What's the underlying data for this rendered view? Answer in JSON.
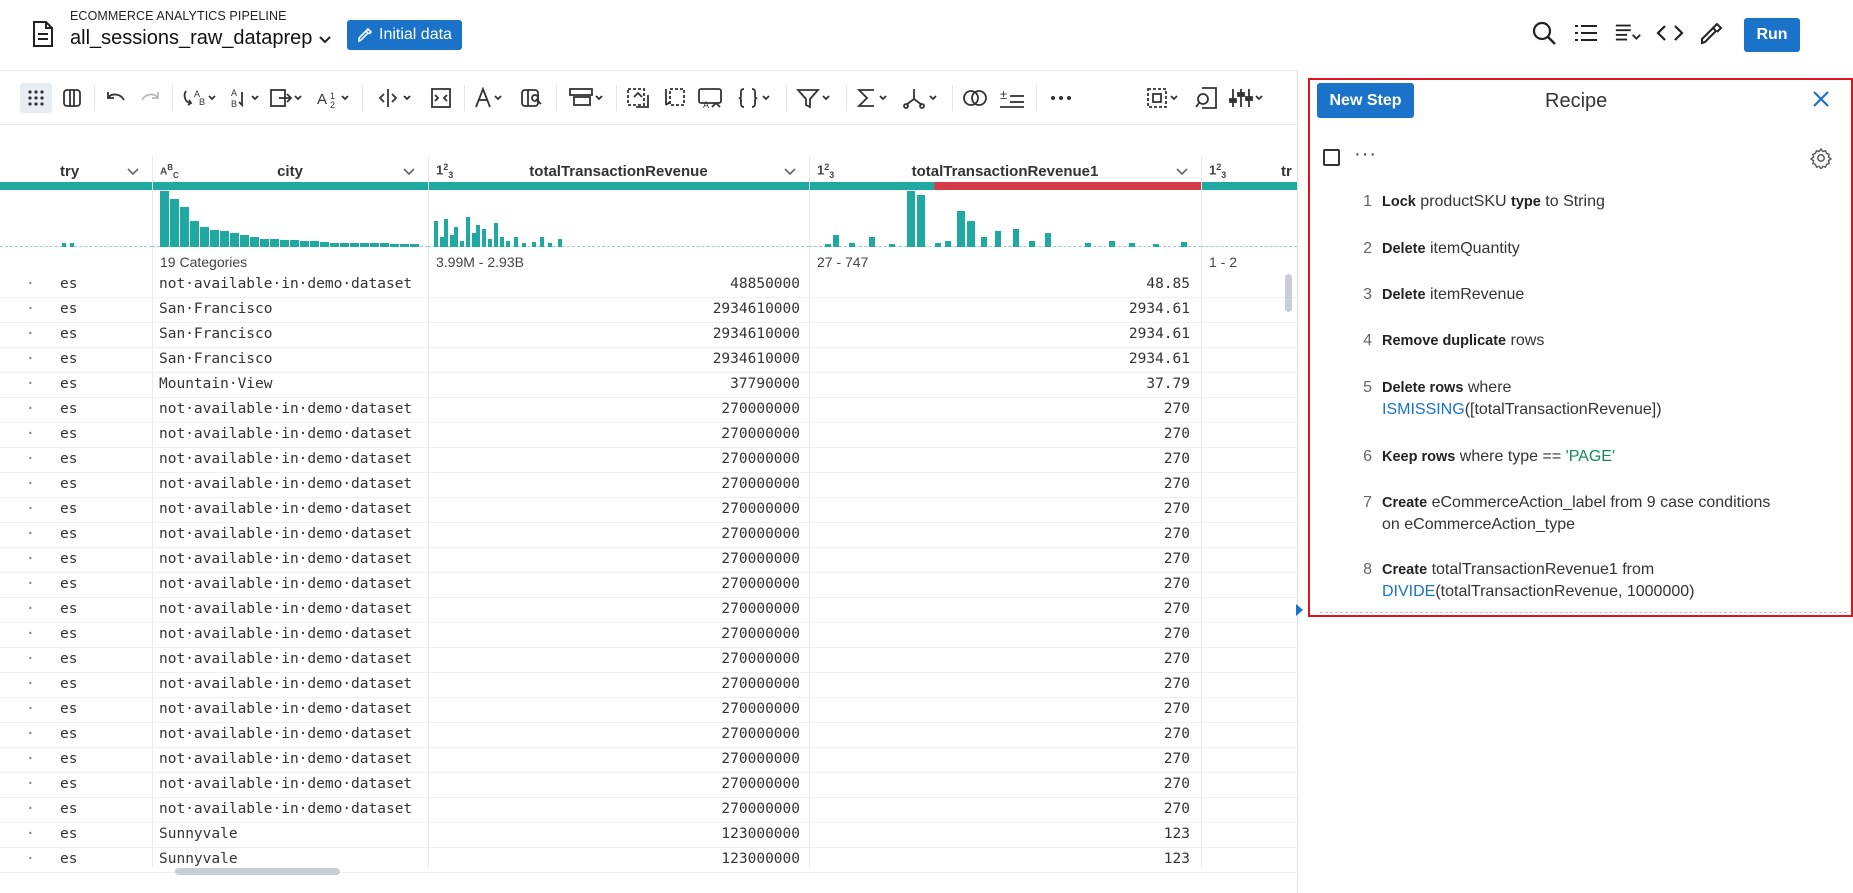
{
  "header": {
    "pipeline_label": "ECOMMERCE ANALYTICS PIPELINE",
    "recipe_name": "all_sessions_raw_dataprep",
    "initial_data_label": "Initial data",
    "run_label": "Run"
  },
  "toolbar": {
    "icons": [
      "grid-view-icon",
      "columns-view-icon",
      "undo-icon",
      "redo-icon",
      "change-type-icon",
      "sort-icon",
      "move-icon",
      "rename-icon",
      "split-icon",
      "merge-icon",
      "format-icon",
      "replace-icon",
      "restructure-icon",
      "nest-icon",
      "unnest-icon",
      "extract-icon",
      "json-icon",
      "filter-icon",
      "aggregate-icon",
      "join-icon",
      "union-icon",
      "new-formula-icon",
      "more-icon",
      "select-icon",
      "lookup-icon",
      "settings-sliders-icon"
    ]
  },
  "grid": {
    "columns": [
      {
        "name": "try",
        "type": "",
        "range": ""
      },
      {
        "name": "city",
        "type": "ABC",
        "range": "19 Categories"
      },
      {
        "name": "totalTransactionRevenue",
        "type": "123",
        "range": "3.99M - 2.93B"
      },
      {
        "name": "totalTransactionRevenue1",
        "type": "123",
        "range": "27 - 747"
      },
      {
        "name": "tr",
        "type": "123",
        "range": "1 - 2"
      }
    ],
    "rows": [
      [
        "es",
        "not available in demo dataset",
        "48850000",
        "48.85"
      ],
      [
        "es",
        "San Francisco",
        "2934610000",
        "2934.61"
      ],
      [
        "es",
        "San Francisco",
        "2934610000",
        "2934.61"
      ],
      [
        "es",
        "San Francisco",
        "2934610000",
        "2934.61"
      ],
      [
        "es",
        "Mountain View",
        "37790000",
        "37.79"
      ],
      [
        "es",
        "not available in demo dataset",
        "270000000",
        "270"
      ],
      [
        "es",
        "not available in demo dataset",
        "270000000",
        "270"
      ],
      [
        "es",
        "not available in demo dataset",
        "270000000",
        "270"
      ],
      [
        "es",
        "not available in demo dataset",
        "270000000",
        "270"
      ],
      [
        "es",
        "not available in demo dataset",
        "270000000",
        "270"
      ],
      [
        "es",
        "not available in demo dataset",
        "270000000",
        "270"
      ],
      [
        "es",
        "not available in demo dataset",
        "270000000",
        "270"
      ],
      [
        "es",
        "not available in demo dataset",
        "270000000",
        "270"
      ],
      [
        "es",
        "not available in demo dataset",
        "270000000",
        "270"
      ],
      [
        "es",
        "not available in demo dataset",
        "270000000",
        "270"
      ],
      [
        "es",
        "not available in demo dataset",
        "270000000",
        "270"
      ],
      [
        "es",
        "not available in demo dataset",
        "270000000",
        "270"
      ],
      [
        "es",
        "not available in demo dataset",
        "270000000",
        "270"
      ],
      [
        "es",
        "not available in demo dataset",
        "270000000",
        "270"
      ],
      [
        "es",
        "not available in demo dataset",
        "270000000",
        "270"
      ],
      [
        "es",
        "not available in demo dataset",
        "270000000",
        "270"
      ],
      [
        "es",
        "not available in demo dataset",
        "270000000",
        "270"
      ],
      [
        "es",
        "Sunnyvale",
        "123000000",
        "123"
      ],
      [
        "es",
        "Sunnyvale",
        "123000000",
        "123"
      ]
    ]
  },
  "recipe": {
    "new_step_label": "New Step",
    "title": "Recipe",
    "steps": [
      {
        "num": "1",
        "parts": [
          [
            "kw",
            "Lock"
          ],
          [
            "t",
            " productSKU "
          ],
          [
            "kw",
            "type"
          ],
          [
            "t",
            " to String"
          ]
        ]
      },
      {
        "num": "2",
        "parts": [
          [
            "kw",
            "Delete"
          ],
          [
            "t",
            " itemQuantity"
          ]
        ]
      },
      {
        "num": "3",
        "parts": [
          [
            "kw",
            "Delete"
          ],
          [
            "t",
            " itemRevenue"
          ]
        ]
      },
      {
        "num": "4",
        "parts": [
          [
            "kw",
            "Remove duplicate"
          ],
          [
            "t",
            " rows"
          ]
        ]
      },
      {
        "num": "5",
        "parts": [
          [
            "kw",
            "Delete rows"
          ],
          [
            "t",
            " where "
          ],
          [
            "br",
            ""
          ],
          [
            "fn",
            "ISMISSING"
          ],
          [
            "t",
            "([totalTransactionRevenue])"
          ]
        ]
      },
      {
        "num": "6",
        "parts": [
          [
            "kw",
            "Keep rows"
          ],
          [
            "t",
            " where type == "
          ],
          [
            "str",
            "'PAGE'"
          ]
        ]
      },
      {
        "num": "7",
        "parts": [
          [
            "kw",
            "Create"
          ],
          [
            "t",
            " eCommerceAction_label from 9 case conditions on eCommerceAction_type"
          ]
        ]
      },
      {
        "num": "8",
        "parts": [
          [
            "kw",
            "Create"
          ],
          [
            "t",
            " totalTransactionRevenue1 from "
          ],
          [
            "br",
            ""
          ],
          [
            "fn",
            "DIVIDE"
          ],
          [
            "t",
            "(totalTransactionRevenue, 1000000)"
          ]
        ]
      }
    ]
  },
  "colors": {
    "accent": "#1a73c8",
    "valid": "#1fa9a0",
    "mismatch": "#d43a48",
    "highlight_border": "#e0141e"
  }
}
